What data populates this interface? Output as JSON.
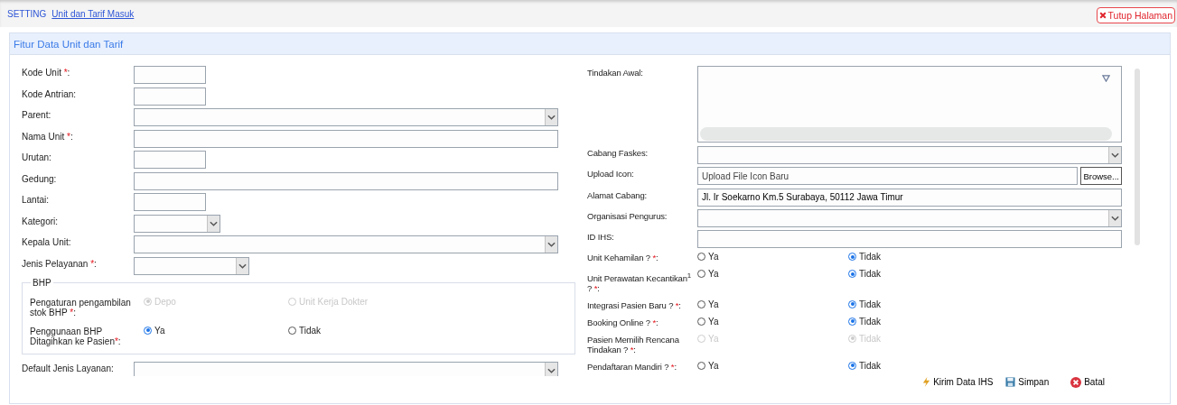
{
  "breadcrumb": {
    "section": "SETTING",
    "current": "Unit dan Tarif Masuk"
  },
  "close_button": {
    "label": "Tutup Halaman"
  },
  "panel": {
    "title": "Fitur Data Unit dan Tarif"
  },
  "left_fields": [
    {
      "kind": "textbox",
      "label": "Kode Unit ",
      "required": "*",
      "end": ":"
    },
    {
      "kind": "textbox",
      "label": "Kode Antrian:"
    },
    {
      "kind": "select",
      "label": "Parent:"
    },
    {
      "kind": "textline",
      "label": "Nama Unit ",
      "required": "*",
      "end": ":"
    },
    {
      "kind": "textbox",
      "label": "Urutan:"
    },
    {
      "kind": "textline",
      "label": "Gedung:"
    },
    {
      "kind": "textbox",
      "label": "Lantai:"
    },
    {
      "kind": "minselect",
      "label": "Kategori:"
    },
    {
      "kind": "select",
      "label": "Kepala Unit:"
    },
    {
      "kind": "midselect",
      "label": "Jenis Pelayanan ",
      "required": "*",
      "end": ":"
    }
  ],
  "bhp": {
    "legend": "BHP",
    "rows": [
      {
        "label": "Pengaturan pengambilan stok BHP ",
        "required": "*",
        "end": ":",
        "disabled": true,
        "options": [
          {
            "label": "Depo",
            "selected": true
          },
          {
            "label": "Unit Kerja Dokter",
            "selected": false
          }
        ]
      },
      {
        "label": "Penggunaan BHP Ditagihkan ke Pasien",
        "required": "*",
        "end": ":",
        "disabled": false,
        "options": [
          {
            "label": "Ya",
            "selected": true
          },
          {
            "label": "Tidak",
            "selected": false
          }
        ]
      }
    ]
  },
  "after_bhp": [
    {
      "kind": "select",
      "label": "Default Jenis Layanan:"
    }
  ],
  "right_fields": [
    {
      "kind": "textarea",
      "label": "Tindakan Awal:"
    },
    {
      "kind": "select",
      "label": "Cabang Faskes:"
    },
    {
      "kind": "file",
      "label": "Upload Icon:",
      "placeholder": "Upload File Icon Baru",
      "button": "Browse..."
    },
    {
      "kind": "text",
      "label": "Alamat Cabang:",
      "value": "Jl. Ir Soekarno Km.5 Surabaya, 50112 Jawa Timur"
    },
    {
      "kind": "select",
      "label": "Organisasi Pengurus:"
    },
    {
      "kind": "text",
      "label": "ID IHS:"
    }
  ],
  "right_radios": [
    {
      "label": "Unit Kehamilan ? ",
      "required": "*",
      "end": ":",
      "disabled": false,
      "options": [
        {
          "label": "Ya",
          "selected": false
        },
        {
          "label": "Tidak",
          "selected": true
        }
      ]
    },
    {
      "label": "Unit Perawatan Kecantikan$^{1}$ ? ",
      "required": "*",
      "end": ":",
      "disabled": false,
      "options": [
        {
          "label": "Ya",
          "selected": false
        },
        {
          "label": "Tidak",
          "selected": true
        }
      ]
    },
    {
      "label": "Integrasi Pasien Baru ? ",
      "required": "*",
      "end": ":",
      "disabled": false,
      "options": [
        {
          "label": "Ya",
          "selected": false
        },
        {
          "label": "Tidak",
          "selected": true
        }
      ]
    },
    {
      "label": "Booking Online ? ",
      "required": "*",
      "end": ":",
      "disabled": false,
      "options": [
        {
          "label": "Ya",
          "selected": false
        },
        {
          "label": "Tidak",
          "selected": true
        }
      ]
    },
    {
      "label": "Pasien Memilih Rencana Tindakan ? ",
      "required": "*",
      "end": ":",
      "disabled": true,
      "options": [
        {
          "label": "Ya",
          "selected": false
        },
        {
          "label": "Tidak",
          "selected": true
        }
      ]
    },
    {
      "label": "Pendaftaran Mandiri ? ",
      "required": "*",
      "end": ":",
      "disabled": false,
      "options": [
        {
          "label": "Ya",
          "selected": false
        },
        {
          "label": "Tidak",
          "selected": true
        }
      ]
    }
  ],
  "actions": [
    {
      "kind": "send",
      "label": "Kirim Data IHS"
    },
    {
      "kind": "save",
      "label": "Simpan"
    },
    {
      "kind": "cancel",
      "label": "Batal"
    }
  ]
}
